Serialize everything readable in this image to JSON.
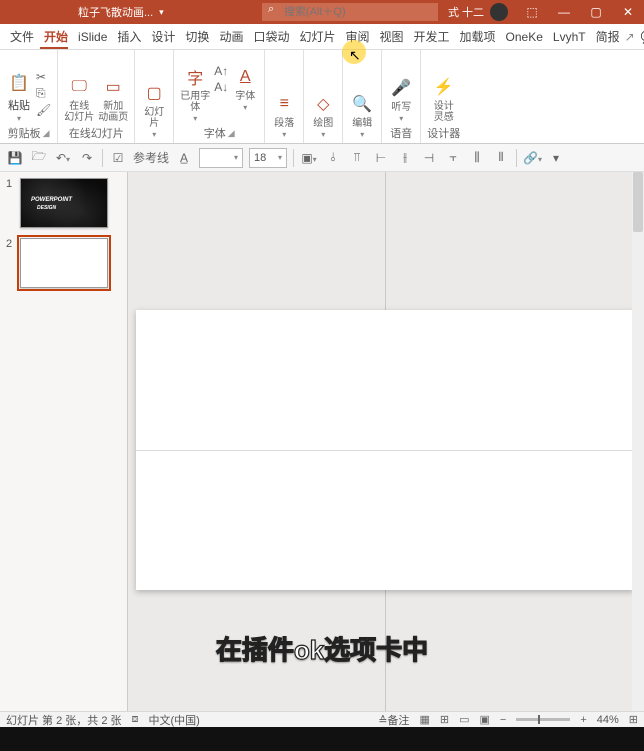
{
  "titlebar": {
    "doc_title": "粒子飞散动画...",
    "search_placeholder": "搜索(Alt＋Q)",
    "user_name": "式 十二",
    "min": "—",
    "max": "▢",
    "close": "✕",
    "tray": "⬚"
  },
  "tabs": {
    "items": [
      "文件",
      "开始",
      "iSlide",
      "插入",
      "设计",
      "切换",
      "动画",
      "口袋动",
      "幻灯片",
      "审阅",
      "视图",
      "开发工",
      "加载项",
      "OneKe",
      "LvyhT",
      "简报"
    ],
    "active_index": 1,
    "share": "↗",
    "comment": "💬"
  },
  "ribbon": {
    "clipboard": {
      "paste": "粘贴",
      "label": "剪贴板"
    },
    "online": {
      "slides": "在线\n幻灯片",
      "newanim": "新加\n动画页",
      "label": "在线幻灯片"
    },
    "slides": {
      "slide": "幻灯\n片",
      "label": ""
    },
    "font": {
      "used": "已用字\n体",
      "font": "字体",
      "label": "字体"
    },
    "para": {
      "label_btn": "段落",
      "label": ""
    },
    "draw": {
      "label_btn": "绘图",
      "label": ""
    },
    "edit": {
      "label_btn": "编辑",
      "label": ""
    },
    "voice": {
      "label_btn": "听写",
      "label": "语音"
    },
    "design": {
      "label_btn": "设计\n灵感",
      "label": "设计器"
    }
  },
  "mini": {
    "guide": "参考线",
    "font_size": "18"
  },
  "thumbs": {
    "s1_num": "1",
    "s1_t1": "POWERPOINT",
    "s1_t2": "DESIGN",
    "s2_num": "2"
  },
  "subtitle": "在插件ok选项卡中",
  "status": {
    "slide_info": "幻灯片 第 2 张，共 2 张",
    "acc": "⧈",
    "lang": "中文(中国)",
    "notes": "≙备注",
    "zoom": "44%",
    "fit": "⊞"
  }
}
